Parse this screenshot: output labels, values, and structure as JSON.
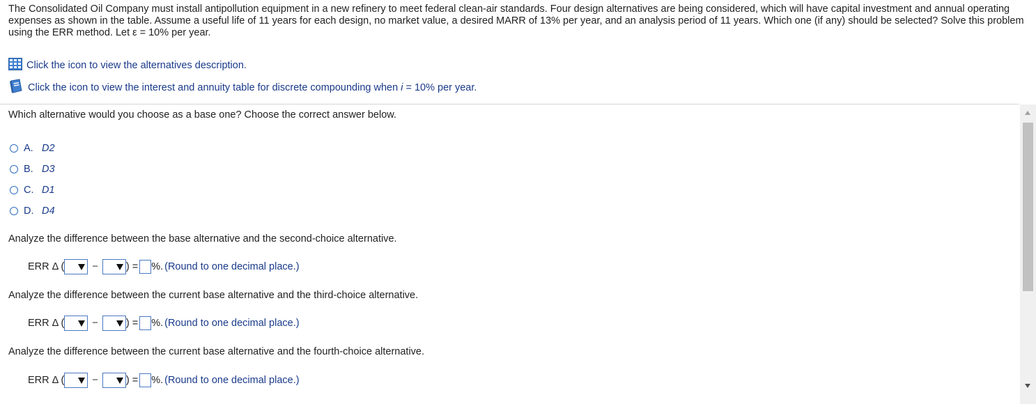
{
  "problem_text": "The Consolidated Oil Company must install antipollution equipment in a new refinery to meet federal clean-air standards. Four design alternatives are being considered, which will have capital investment and annual operating expenses as shown in the table. Assume a useful life of 11 years for each design, no market value, a desired MARR of 13% per year, and an analysis period of 11 years. Which one (if any) should be selected? Solve this problem using the ERR method. Let ε = 10% per year.",
  "links": {
    "alternatives": "Click the icon to view the alternatives description.",
    "table_prefix": "Click the icon to view the interest and annuity table for discrete compounding when ",
    "table_var": "i",
    "table_suffix": " = 10% per year."
  },
  "question": "Which alternative would you choose as a base one? Choose the correct answer below.",
  "options": [
    {
      "letter": "A.",
      "value": "D2"
    },
    {
      "letter": "B.",
      "value": "D3"
    },
    {
      "letter": "C.",
      "value": "D1"
    },
    {
      "letter": "D.",
      "value": "D4"
    }
  ],
  "analyses": [
    {
      "text": "Analyze the difference between the base alternative and the second-choice alternative."
    },
    {
      "text": "Analyze the difference between the current base alternative and the third-choice alternative."
    },
    {
      "text": "Analyze the difference between the current base alternative and the fourth-choice alternative."
    }
  ],
  "err": {
    "label": "ERR Δ (",
    "minus": "−",
    "close": ") =",
    "percent": "%.",
    "hint": "(Round to one decimal place.)"
  },
  "icons": {
    "table_icon": "grid-table-icon",
    "book_icon": "book-icon"
  },
  "colors": {
    "link": "#1a3a8a",
    "accent": "#2f6fc1"
  }
}
